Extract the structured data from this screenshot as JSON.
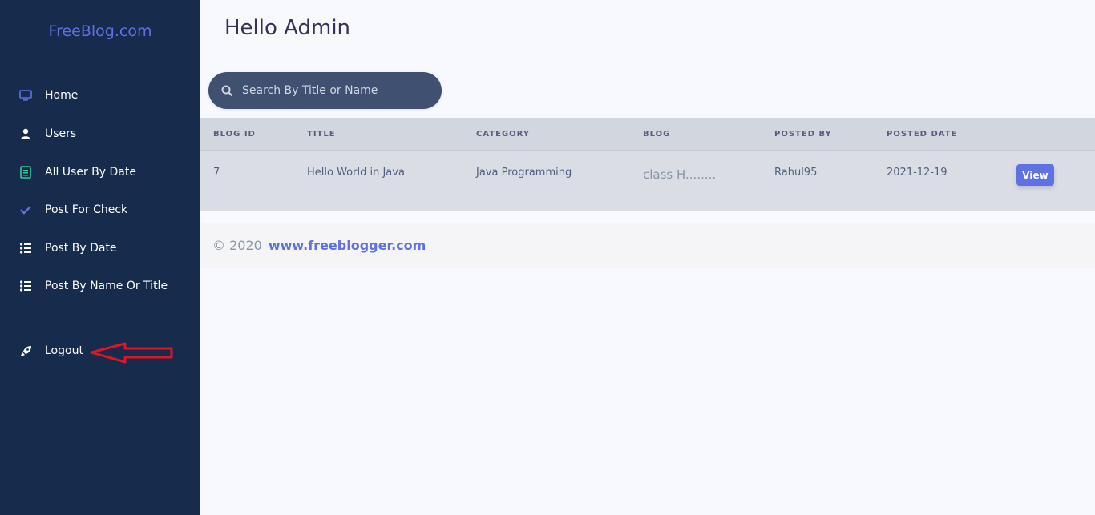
{
  "sidebar": {
    "brand": "FreeBlog.com",
    "items": [
      {
        "label": "Home",
        "icon": "monitor-icon"
      },
      {
        "label": "Users",
        "icon": "user-icon"
      },
      {
        "label": "All User By Date",
        "icon": "calendar-icon"
      },
      {
        "label": "Post For Check",
        "icon": "check-icon"
      },
      {
        "label": "Post By Date",
        "icon": "list-icon"
      },
      {
        "label": "Post By Name Or Title",
        "icon": "list-icon"
      }
    ],
    "logout": {
      "label": "Logout",
      "icon": "rocket-icon"
    }
  },
  "header": {
    "title": "Hello Admin"
  },
  "search": {
    "placeholder": "Search By Title or Name"
  },
  "table": {
    "columns": [
      "Blog ID",
      "Title",
      "Category",
      "Blog",
      "Posted By",
      "Posted Date"
    ],
    "rows": [
      {
        "blog_id": "7",
        "title": "Hello World in Java",
        "category": "Java Programming",
        "blog": "class H........",
        "posted_by": "Rahul95",
        "posted_date": "2021-12-19",
        "action": "View"
      }
    ]
  },
  "footer": {
    "copyright": "© 2020",
    "link": "www.freeblogger.com"
  },
  "colors": {
    "sidebar": "#172b4d",
    "accent": "#5e72e4",
    "annotation_arrow": "#e0151f"
  }
}
